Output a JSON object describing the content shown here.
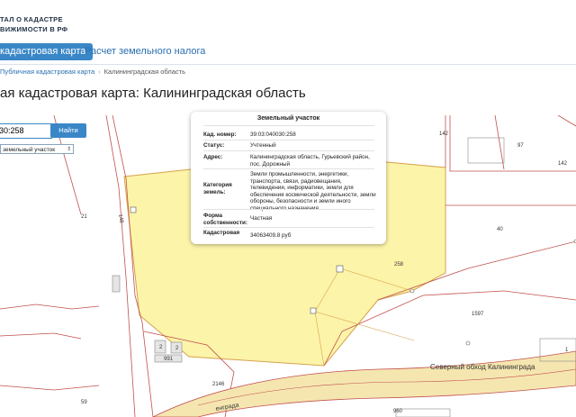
{
  "site": {
    "title_line1": "ТАЛ О КАДАСТРЕ",
    "title_line2": "ВИЖИМОСТИ В РФ"
  },
  "tabs": [
    {
      "label": "кадастровая карта",
      "active": true
    },
    {
      "label": "Расчет земельного налога",
      "active": false
    }
  ],
  "breadcrumb": {
    "link": "Публичная кадастровая карта",
    "separator": "›",
    "current": "Калининградская область"
  },
  "page_title": "ая кадастровая карта: Калининградская область",
  "search": {
    "value": "30:258",
    "button_label": "Найти",
    "type_select": "земельный участок"
  },
  "popup": {
    "title": "Земельный участок",
    "rows": [
      {
        "key": "Кад. номер:",
        "value": "39:03:040030:258"
      },
      {
        "key": "Статус:",
        "value": "Учтенный"
      },
      {
        "key": "Адрес:",
        "value": "Калининградская область, Гурьевский район, пос. Дорожный"
      },
      {
        "key": "Категория земель:",
        "value": "Земли промышленности, энергетики, транспорта, связи, радиовещания, телевидения, информатики, земли для обеспечения космической деятельности, земли обороны, безопасности и земли иного специального назначения"
      },
      {
        "key": "Форма собственности:",
        "value": "Частная"
      },
      {
        "key": "Кадастровая",
        "value": "34063409.8 руб"
      }
    ]
  },
  "map_labels": {
    "parcel_numbers": [
      "142",
      "97",
      "142",
      "40",
      "21",
      "148",
      "258",
      "1597",
      "1",
      "991",
      "59",
      "2146",
      "960",
      "2",
      "2"
    ],
    "road_name": "Северный обход Калининграда",
    "road_name_partial": "енграда"
  },
  "colors": {
    "accent": "#3a87c8",
    "parcel_fill": "#fbf29a",
    "parcel_border": "#d7a24a",
    "boundary": "#c0504d",
    "road_fill": "#f5e6b0"
  }
}
